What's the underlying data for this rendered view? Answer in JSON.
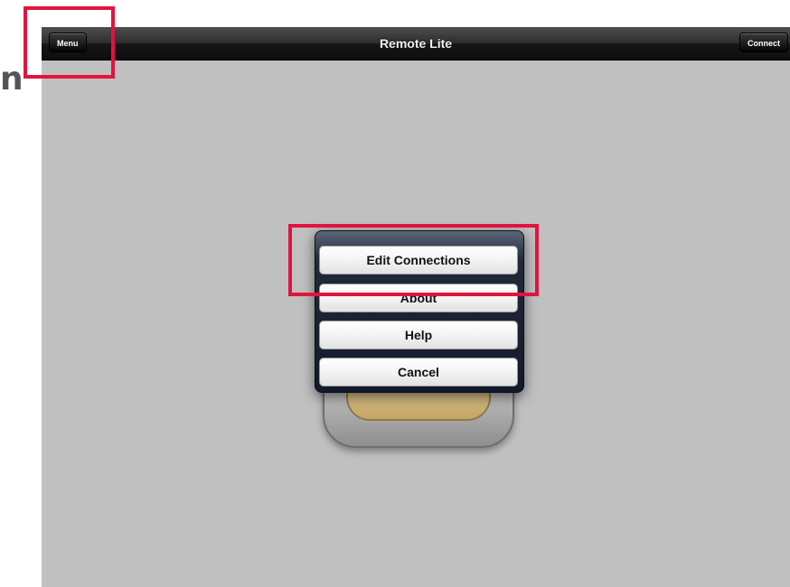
{
  "app": {
    "title": "Remote Lite"
  },
  "navbar": {
    "menu_label": "Menu",
    "connect_label": "Connect"
  },
  "side_letter": "n",
  "menu": {
    "options": [
      {
        "label": "Edit Connections"
      },
      {
        "label": "About"
      },
      {
        "label": "Help"
      },
      {
        "label": "Cancel"
      }
    ]
  },
  "colors": {
    "background": "#c0c0c0",
    "navbar": "#1a1a1a",
    "highlight": "#e2133f"
  }
}
